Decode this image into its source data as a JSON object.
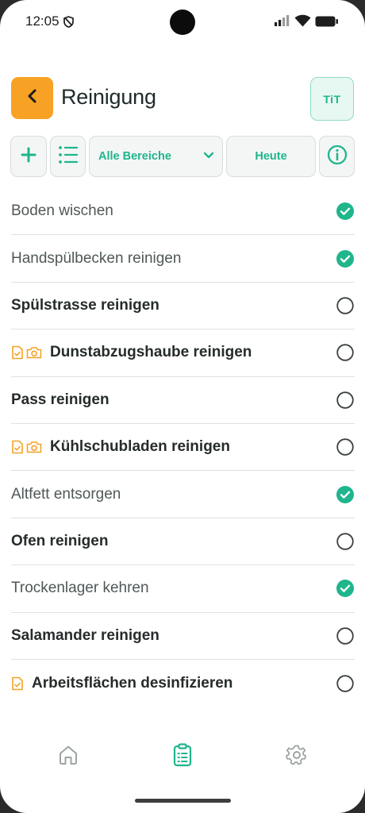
{
  "status_bar": {
    "time": "12:05"
  },
  "header": {
    "title": "Reinigung",
    "avatar_initials": "TiT"
  },
  "toolbar": {
    "area_select": "Alle Bereiche",
    "date_filter": "Heute"
  },
  "colors": {
    "accent": "#1fb58d",
    "back_button": "#f7a224",
    "doc_icon": "#f4a326"
  },
  "tasks": [
    {
      "label": "Boden wischen",
      "done": true,
      "icons": []
    },
    {
      "label": "Handspülbecken reinigen",
      "done": true,
      "icons": []
    },
    {
      "label": "Spülstrasse reinigen",
      "done": false,
      "icons": []
    },
    {
      "label": "Dunstabzugshaube reinigen",
      "done": false,
      "icons": [
        "document-check-icon",
        "camera-icon"
      ]
    },
    {
      "label": "Pass reinigen",
      "done": false,
      "icons": []
    },
    {
      "label": "Kühlschubladen reinigen",
      "done": false,
      "icons": [
        "document-check-icon",
        "camera-icon"
      ]
    },
    {
      "label": "Altfett entsorgen",
      "done": true,
      "icons": []
    },
    {
      "label": "Ofen reinigen",
      "done": false,
      "icons": []
    },
    {
      "label": "Trockenlager kehren",
      "done": true,
      "icons": []
    },
    {
      "label": "Salamander reinigen",
      "done": false,
      "icons": []
    },
    {
      "label": "Arbeitsflächen desinfizieren",
      "done": false,
      "icons": [
        "document-check-icon"
      ]
    }
  ],
  "bottom_nav": [
    "home-icon",
    "clipboard-icon",
    "gear-icon"
  ]
}
